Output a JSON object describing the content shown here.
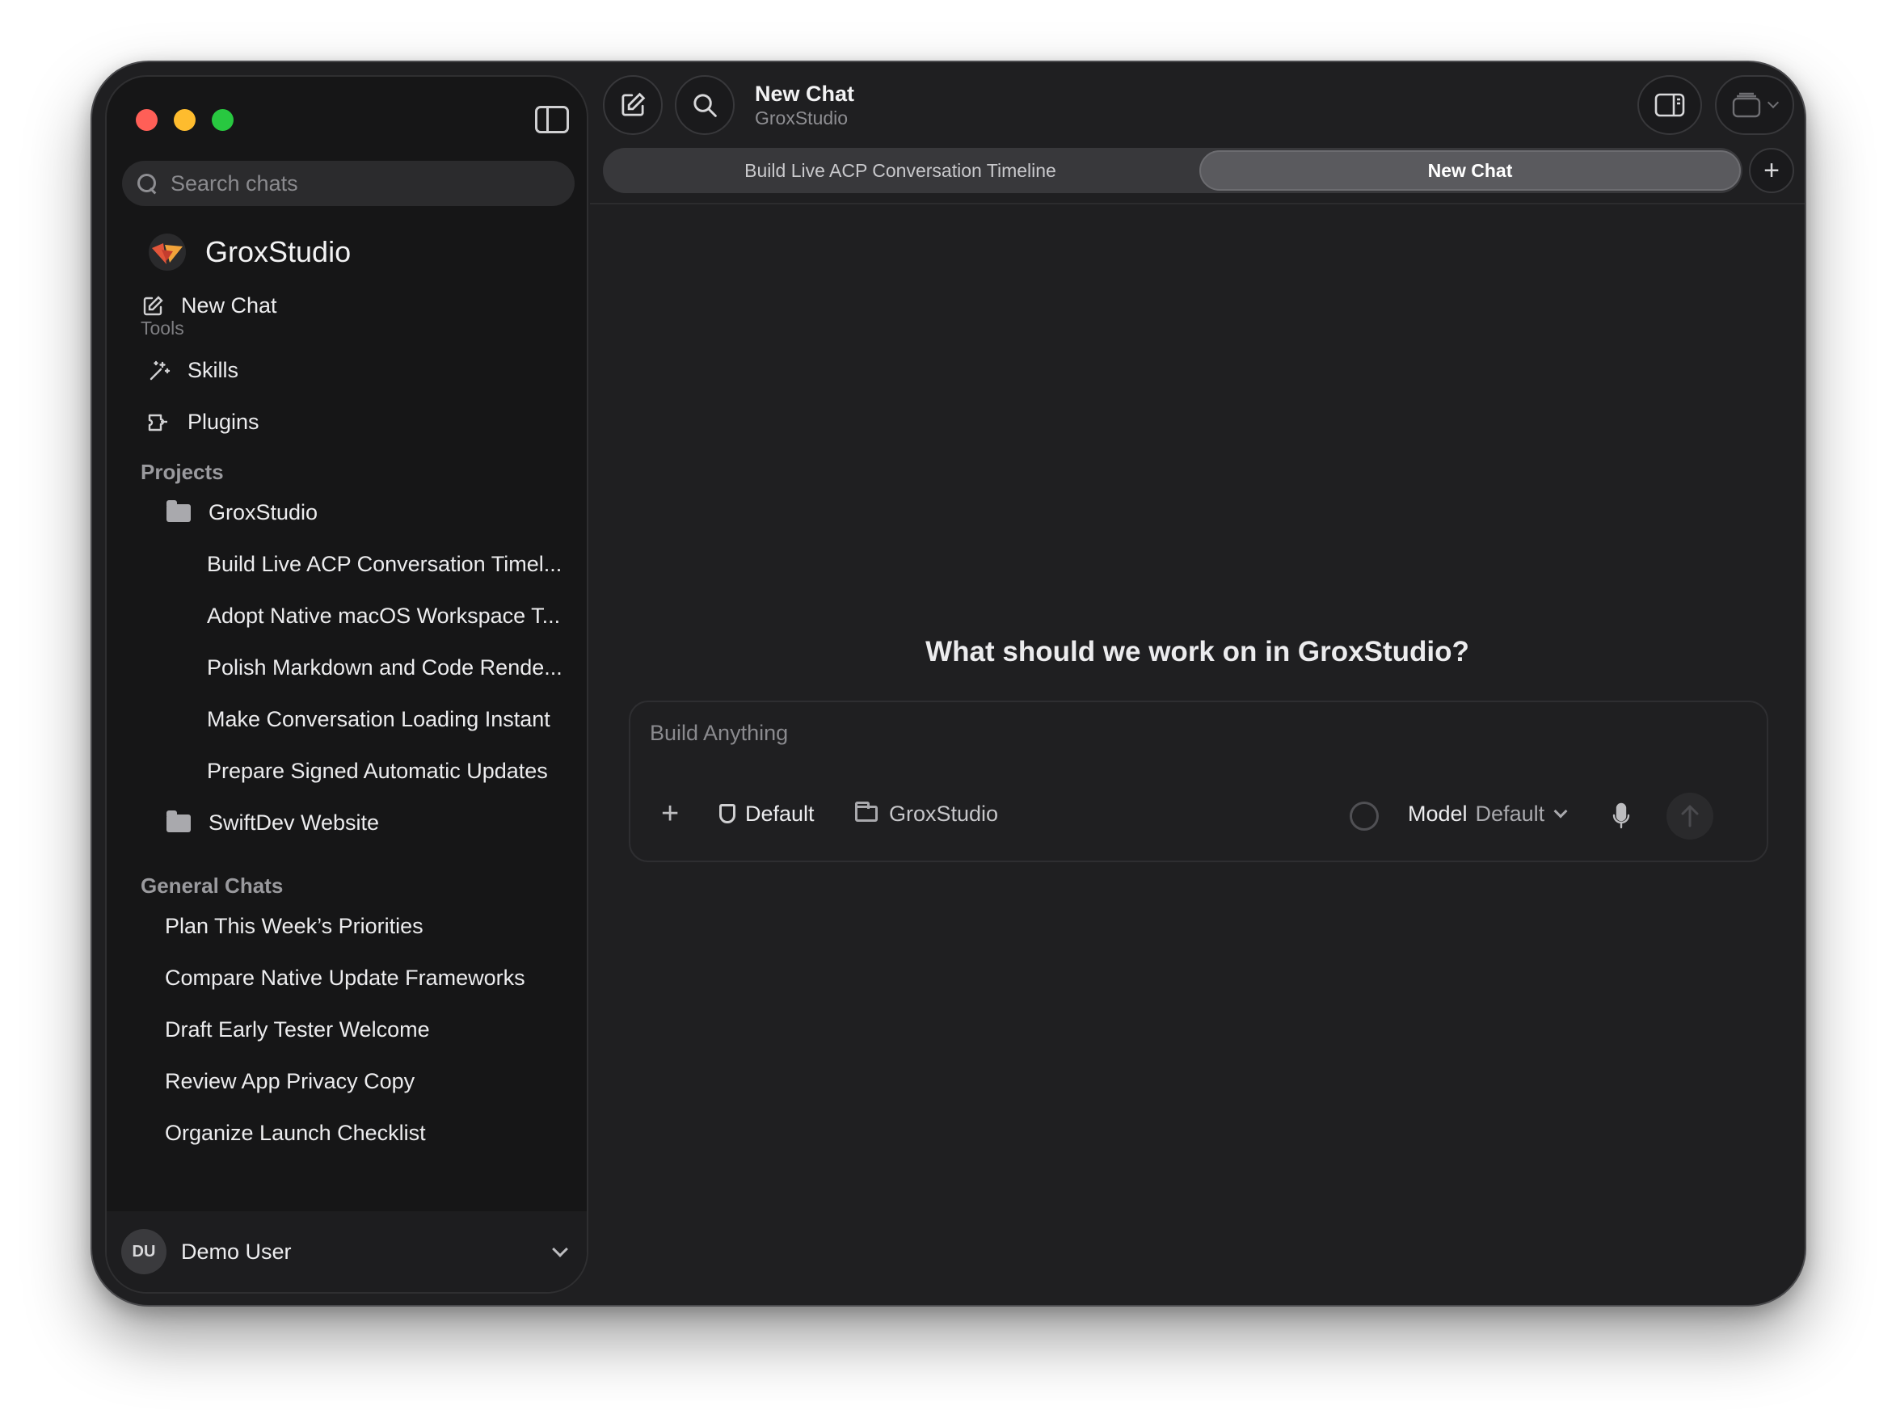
{
  "sidebar": {
    "search_placeholder": "Search chats",
    "brand_title": "GroxStudio",
    "new_chat_label": "New Chat",
    "tools_label": "Tools",
    "tools": [
      {
        "label": "Skills",
        "icon": "wand-icon"
      },
      {
        "label": "Plugins",
        "icon": "plugin-icon"
      }
    ],
    "projects_label": "Projects",
    "projects": [
      {
        "name": "GroxStudio",
        "chats": [
          "Build Live ACP Conversation Timel...",
          "Adopt Native macOS Workspace T...",
          "Polish Markdown and Code Rende...",
          "Make Conversation Loading Instant",
          "Prepare Signed Automatic Updates"
        ]
      },
      {
        "name": "SwiftDev Website",
        "chats": []
      }
    ],
    "general_label": "General Chats",
    "general_chats": [
      "Plan This Week’s Priorities",
      "Compare Native Update Frameworks",
      "Draft Early Tester Welcome",
      "Review App Privacy Copy",
      "Organize Launch Checklist"
    ],
    "user": {
      "initials": "DU",
      "name": "Demo User"
    }
  },
  "header": {
    "title": "New Chat",
    "subtitle": "GroxStudio"
  },
  "tabs": [
    {
      "label": "Build Live ACP Conversation Timeline",
      "active": false
    },
    {
      "label": "New Chat",
      "active": true
    }
  ],
  "main": {
    "heading": "What should we work on in GroxStudio?",
    "composer": {
      "placeholder": "Build Anything",
      "mode_label": "Default",
      "project_label": "GroxStudio",
      "model_label": "Model",
      "model_value": "Default"
    }
  },
  "colors": {
    "window_bg": "#1f1f21",
    "sidebar_bg": "#161617",
    "close": "#ff5f57",
    "minimize": "#febc2e",
    "zoom": "#28c840",
    "active_tab": "#5a5a5e"
  }
}
